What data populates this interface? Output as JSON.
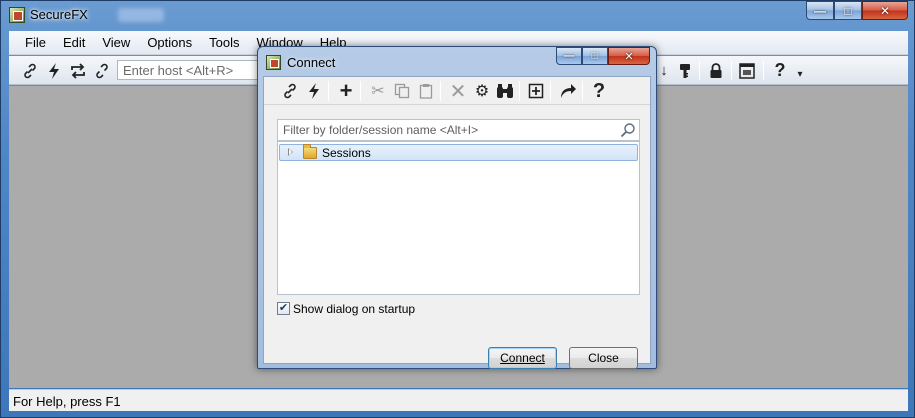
{
  "app": {
    "title": "SecureFX"
  },
  "menu": [
    "File",
    "Edit",
    "View",
    "Options",
    "Tools",
    "Window",
    "Help"
  ],
  "toolbar": {
    "host_placeholder": "Enter host <Alt+R>",
    "icons": [
      "connect-icon",
      "quick-connect-icon",
      "reconnect-icon",
      "disconnect-icon"
    ]
  },
  "status": {
    "text": "For Help, press F1"
  },
  "dialog": {
    "title": "Connect",
    "toolbar_icons": [
      "connect-link-icon",
      "quick-connect-icon",
      "new-session-icon",
      "cut-icon",
      "copy-icon",
      "paste-icon",
      "delete-icon",
      "properties-icon",
      "find-icon",
      "new-folder-icon",
      "create-shortcut-icon",
      "help-icon"
    ],
    "filter_placeholder": "Filter by folder/session name <Alt+I>",
    "tree": [
      {
        "label": "Sessions",
        "type": "folder",
        "expanded": false,
        "selected": true
      }
    ],
    "show_on_startup": {
      "label": "Show dialog on startup",
      "checked": true
    },
    "connect_label": "Connect",
    "close_label": "Close"
  }
}
